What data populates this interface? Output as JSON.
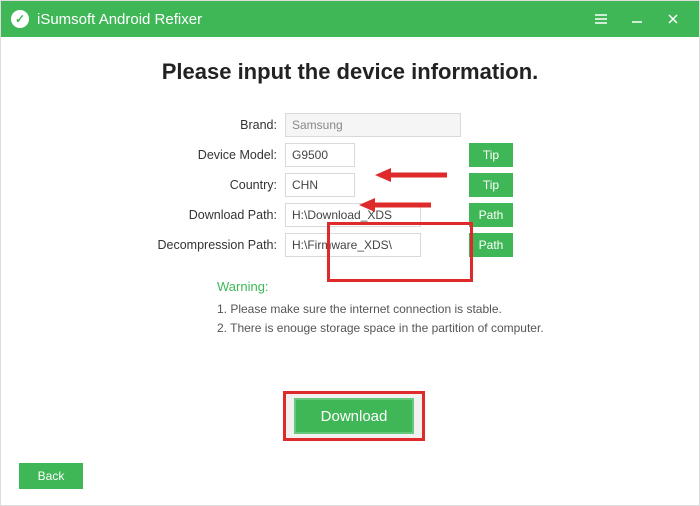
{
  "window": {
    "title": "iSumsoft Android Refixer"
  },
  "heading": "Please input the device information.",
  "form": {
    "brand_label": "Brand:",
    "brand_value": "Samsung",
    "model_label": "Device Model:",
    "model_value": "G9500",
    "country_label": "Country:",
    "country_value": "CHN",
    "dlpath_label": "Download Path:",
    "dlpath_value": "H:\\Download_XDS",
    "decomp_label": "Decompression Path:",
    "decomp_value": "H:\\Firmware_XDS\\",
    "tip_btn": "Tip",
    "path_btn": "Path"
  },
  "warning": {
    "title": "Warning:",
    "line1": "1. Please make sure the internet connection is stable.",
    "line2": "2. There is enouge storage space in the partition of computer."
  },
  "buttons": {
    "download": "Download",
    "back": "Back"
  }
}
